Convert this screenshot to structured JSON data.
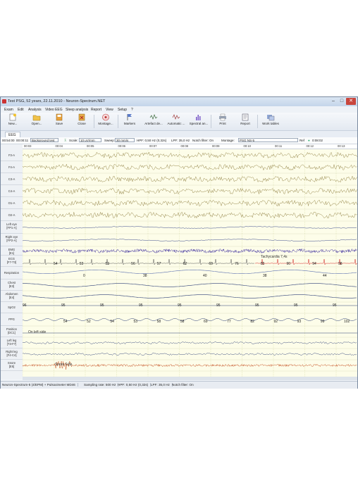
{
  "window": {
    "title": "Test PSG, 52 years, 22.11.2010 - Neuron-Spectrum.NET",
    "min": "–",
    "max": "□",
    "close": "✕"
  },
  "menu": [
    "Exam",
    "Edit",
    "Analysis",
    "Video EEG",
    "Sleep analysis",
    "Report",
    "View",
    "Setup",
    "?"
  ],
  "toolbar": [
    {
      "label": "New...",
      "icon": "new-icon"
    },
    {
      "label": "Open...",
      "icon": "open-icon"
    },
    {
      "label": "Save",
      "icon": "save-icon"
    },
    {
      "label": "Close",
      "icon": "close-file-icon"
    },
    {
      "label": "Montage...",
      "icon": "montage-icon"
    },
    {
      "label": "Markers",
      "icon": "markers-icon"
    },
    {
      "label": "Artefact de...",
      "icon": "artefact-icon"
    },
    {
      "label": "Automatic ...",
      "icon": "automatic-icon"
    },
    {
      "label": "Spectral an...",
      "icon": "spectral-icon"
    },
    {
      "label": "Print",
      "icon": "print-icon"
    },
    {
      "label": "Report",
      "icon": "report-icon"
    },
    {
      "label": "Work tables",
      "icon": "worktables-icon"
    }
  ],
  "tab": {
    "label": "EEG"
  },
  "controls": {
    "time": "00:54:00",
    "elapsed": "00:00:11",
    "test": "Background test",
    "scale_label": "Scale:",
    "scale": "10 μV/mm",
    "sweep_label": "Sweep:",
    "sweep": "30 mm/s",
    "hpf": "HPF: 0,50 Hz (0,32s)",
    "lpf": "LPF: 35,0 Hz",
    "notch": "Notch filter: On",
    "montage_label": "Montage:",
    "montage": "PSG NS-5",
    "ref": "Ref",
    "duration": "0:08:02"
  },
  "time_labels": [
    "00:03",
    "00:04",
    "00:05",
    "00:06",
    "00:07",
    "00:08",
    "00:09",
    "00:10",
    "00:11",
    "00:12",
    "00:13"
  ],
  "channels": [
    {
      "name": "F3-A",
      "sub": ""
    },
    {
      "name": "F4-A",
      "sub": ""
    },
    {
      "name": "C3-A",
      "sub": ""
    },
    {
      "name": "C4-A",
      "sub": ""
    },
    {
      "name": "O1-A",
      "sub": ""
    },
    {
      "name": "O2-A",
      "sub": ""
    },
    {
      "name": "Left eye",
      "sub": "[FP1-A]"
    },
    {
      "name": "Right eye",
      "sub": "[FP2-A]"
    },
    {
      "name": "EMG",
      "sub": "[E1]"
    },
    {
      "name": "ECG",
      "sub": "[F7-T3]"
    },
    {
      "name": "Respiration",
      "sub": ""
    },
    {
      "name": "Chest",
      "sub": "[E3]"
    },
    {
      "name": "Abdomen",
      "sub": "[E4]"
    },
    {
      "name": "SpO2",
      "sub": ""
    },
    {
      "name": "PPG",
      "sub": ""
    },
    {
      "name": "Position",
      "sub": "[DC1]"
    },
    {
      "name": "Left leg",
      "sub": "[T3-F7]"
    },
    {
      "name": "Right leg",
      "sub": "[F4-C4]"
    },
    {
      "name": "Snore",
      "sub": "[E5]"
    }
  ],
  "annotations": {
    "tachycardia": "Tachycardia 7,4s",
    "position": "On left side",
    "snore": "Snore 0,8s"
  },
  "ecg_values": [
    "54",
    "53",
    "53",
    "56",
    "57",
    "62",
    "69",
    "76",
    "85",
    "90",
    "94",
    "98"
  ],
  "respiration_values": [
    "0",
    "38",
    "40",
    "38",
    "44"
  ],
  "spo2_values": [
    "96",
    "95",
    "95",
    "95",
    "95",
    "95",
    "95",
    "95",
    "95"
  ],
  "ppg_values": [
    "54",
    "52",
    "54",
    "53",
    "58",
    "58",
    "69",
    "77",
    "82",
    "92",
    "93",
    "99",
    "102"
  ],
  "statusbar": [
    "Neuron-Spectrum-5 (4/EPM) + Pulsoximeter MD46",
    "Sampling rate: 500 Hz",
    "HPF: 0,50 Hz (0,32s)",
    "LPF: 35,0 Hz",
    "Notch filter: On"
  ],
  "colors": {
    "eeg": "#8b7a3a",
    "eog": "#3b4a8c",
    "emg": "#3a2a9c",
    "ecg": "#555",
    "resp": "#5a6fb0",
    "trace": "#2c3e78",
    "ecg_red": "#d02020",
    "snore": "#c04010"
  }
}
